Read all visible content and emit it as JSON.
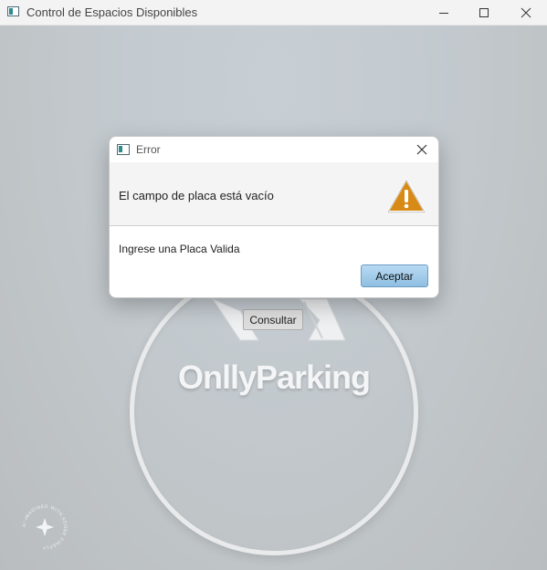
{
  "window": {
    "title": "Control de Espacios Disponibles",
    "icon": "java-app-icon",
    "controls": [
      "minimize-icon",
      "maximize-icon",
      "close-icon"
    ]
  },
  "main": {
    "brand": "OnllyParking",
    "consult_button": "Consultar",
    "watermark": "AI-IMAGINED WITH ADOBE FIREFLY"
  },
  "dialog": {
    "title": "Error",
    "header_text": "El campo de placa está vacío",
    "message": "Ingrese una Placa Valida",
    "accept_button": "Aceptar",
    "icon": "warning-icon",
    "accent_color": "#d88a16"
  }
}
